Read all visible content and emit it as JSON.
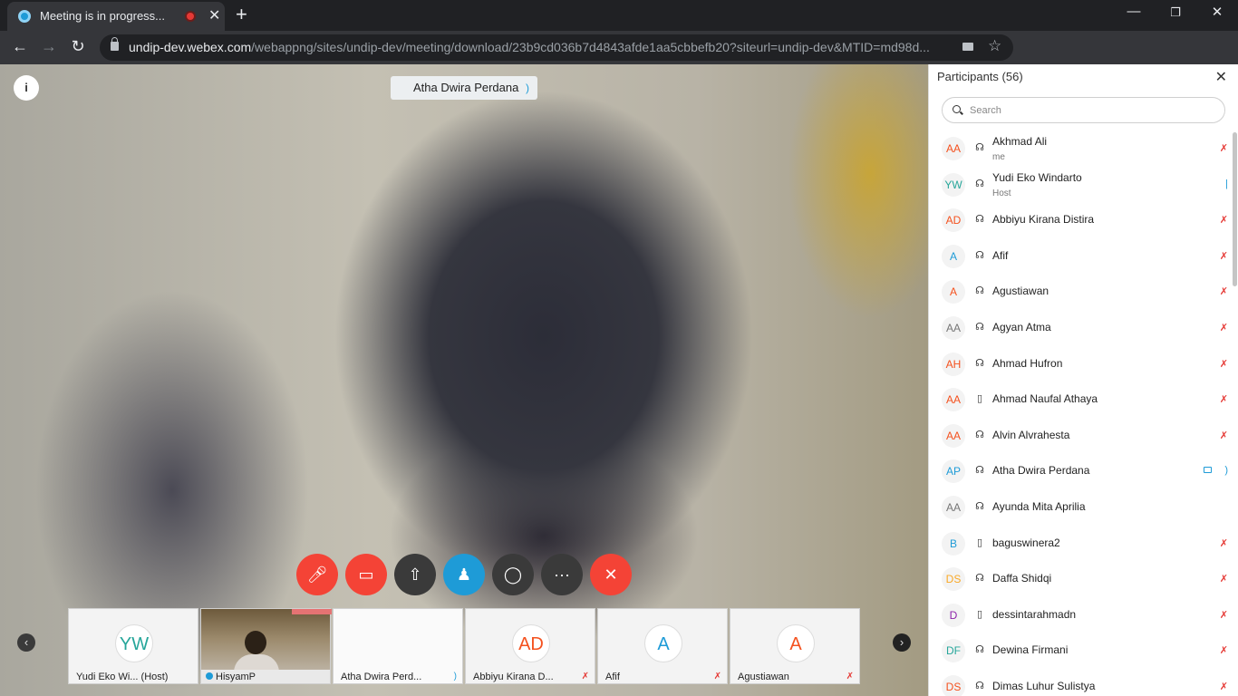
{
  "browser": {
    "tab_title": "Meeting is in progress...",
    "url_host": "undip-dev.webex.com",
    "url_path": "/webappng/sites/undip-dev/meeting/download/23b9cd036b7d4843afde1aa5cbbefb20?siteurl=undip-dev&MTID=md98d..."
  },
  "stage": {
    "active_speaker": "Atha Dwira Perdana",
    "info_icon": "info-icon"
  },
  "controls": [
    {
      "name": "mute-button",
      "icon": "mic-off-icon",
      "color": "#f44336"
    },
    {
      "name": "stop-video-button",
      "icon": "video-off-icon",
      "color": "#f44336"
    },
    {
      "name": "share-button",
      "icon": "share-icon",
      "color": "#3a3a3a"
    },
    {
      "name": "participants-button",
      "icon": "participants-icon",
      "color": "#1e9bd7"
    },
    {
      "name": "chat-button",
      "icon": "chat-icon",
      "color": "#3a3a3a"
    },
    {
      "name": "more-button",
      "icon": "more-icon",
      "color": "#3a3a3a"
    },
    {
      "name": "leave-button",
      "icon": "close-icon",
      "color": "#f44336"
    }
  ],
  "thumbnails": [
    {
      "initials": "YW",
      "label": "Yudi Eko Wi...  (Host)",
      "color": "#26a69a",
      "muted": false
    },
    {
      "initials": "",
      "label": "HisyamP",
      "video": true
    },
    {
      "initials": "",
      "label": "Atha Dwira Perd...",
      "blank": true
    },
    {
      "initials": "AD",
      "label": "Abbiyu Kirana D...",
      "color": "#f4511e",
      "muted": true
    },
    {
      "initials": "A",
      "label": "Afif",
      "color": "#1e9bd7",
      "muted": true
    },
    {
      "initials": "A",
      "label": "Agustiawan",
      "color": "#f4511e",
      "muted": true
    }
  ],
  "panel": {
    "title": "Participants (56)",
    "search_placeholder": "Search",
    "participants": [
      {
        "initials": "AA",
        "color": "#f4511e",
        "name": "Akhmad Ali",
        "sub": "me",
        "device": "headset",
        "mic": "muted"
      },
      {
        "initials": "YW",
        "color": "#26a69a",
        "name": "Yudi Eko Windarto",
        "sub": "Host",
        "device": "headset",
        "mic": "on"
      },
      {
        "initials": "AD",
        "color": "#f4511e",
        "name": "Abbiyu Kirana Distira",
        "sub": "",
        "device": "headset",
        "mic": "muted"
      },
      {
        "initials": "A",
        "color": "#1e9bd7",
        "name": "Afif",
        "sub": "",
        "device": "headset",
        "mic": "muted"
      },
      {
        "initials": "A",
        "color": "#f4511e",
        "name": "Agustiawan",
        "sub": "",
        "device": "headset",
        "mic": "muted"
      },
      {
        "initials": "AA",
        "color": "#757575",
        "name": "Agyan Atma",
        "sub": "",
        "device": "headset",
        "mic": "muted"
      },
      {
        "initials": "AH",
        "color": "#f4511e",
        "name": "Ahmad Hufron",
        "sub": "",
        "device": "headset",
        "mic": "muted"
      },
      {
        "initials": "AA",
        "color": "#f4511e",
        "name": "Ahmad Naufal Athaya",
        "sub": "",
        "device": "phone",
        "mic": "muted"
      },
      {
        "initials": "AA",
        "color": "#f4511e",
        "name": "Alvin Alvrahesta",
        "sub": "",
        "device": "headset",
        "mic": "muted"
      },
      {
        "initials": "AP",
        "color": "#1e9bd7",
        "name": "Atha Dwira Perdana",
        "sub": "",
        "device": "headset",
        "mic": "speaking",
        "video": true
      },
      {
        "initials": "AA",
        "color": "#757575",
        "name": "Ayunda Mita Aprilia",
        "sub": "",
        "device": "headset",
        "mic": "none"
      },
      {
        "initials": "B",
        "color": "#1e9bd7",
        "name": "baguswinera2",
        "sub": "",
        "device": "phone",
        "mic": "muted"
      },
      {
        "initials": "DS",
        "color": "#f9a825",
        "name": "Daffa Shidqi",
        "sub": "",
        "device": "headset",
        "mic": "muted"
      },
      {
        "initials": "D",
        "color": "#8e24aa",
        "name": "dessintarahmadn",
        "sub": "",
        "device": "phone",
        "mic": "muted"
      },
      {
        "initials": "DF",
        "color": "#26a69a",
        "name": "Dewina Firmani",
        "sub": "",
        "device": "headset",
        "mic": "muted"
      },
      {
        "initials": "DS",
        "color": "#f4511e",
        "name": "Dimas Luhur Sulistya",
        "sub": "",
        "device": "headset",
        "mic": "muted"
      }
    ]
  }
}
